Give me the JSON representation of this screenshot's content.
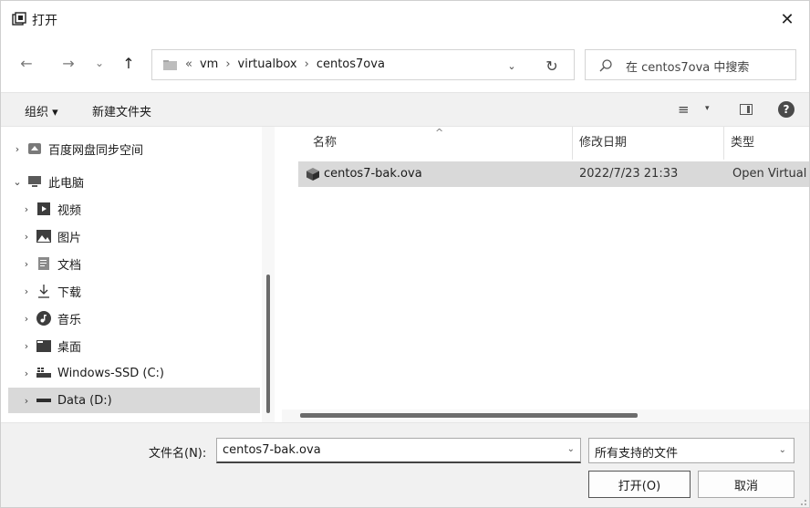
{
  "window": {
    "title": "打开",
    "close_glyph": "✕"
  },
  "nav": {
    "back_glyph": "←",
    "forward_glyph": "→",
    "recent_glyph": "⌄",
    "up_glyph": "↑"
  },
  "address": {
    "overflow": "«",
    "segments": [
      "vm",
      "virtualbox",
      "centos7ova"
    ],
    "separator": "›",
    "dropdown_glyph": "⌄",
    "refresh_glyph": "↻"
  },
  "search": {
    "placeholder": "在 centos7ova 中搜索"
  },
  "toolbar": {
    "organize_label": "组织 ▾",
    "new_folder_label": "新建文件夹",
    "view_glyph": "≡",
    "view_drop_glyph": "▾",
    "help_glyph": "?"
  },
  "sidebar": {
    "items": [
      {
        "label": "百度网盘同步空间",
        "chevron": "›",
        "icon": "cloud-sync-icon"
      },
      {
        "label": "此电脑",
        "chevron": "⌄",
        "icon": "computer-icon"
      },
      {
        "label": "视频",
        "chevron": "›",
        "icon": "video-icon"
      },
      {
        "label": "图片",
        "chevron": "›",
        "icon": "pictures-icon"
      },
      {
        "label": "文档",
        "chevron": "›",
        "icon": "documents-icon"
      },
      {
        "label": "下载",
        "chevron": "›",
        "icon": "download-icon"
      },
      {
        "label": "音乐",
        "chevron": "›",
        "icon": "music-icon"
      },
      {
        "label": "桌面",
        "chevron": "›",
        "icon": "desktop-icon"
      },
      {
        "label": "Windows-SSD (C:)",
        "chevron": "›",
        "icon": "drive-c-icon"
      },
      {
        "label": "Data (D:)",
        "chevron": "›",
        "icon": "drive-d-icon"
      }
    ]
  },
  "file_list": {
    "columns": {
      "name": "名称",
      "modified": "修改日期",
      "type": "类型",
      "sort_glyph": "^"
    },
    "rows": [
      {
        "name": "centos7-bak.ova",
        "modified": "2022/7/23 21:33",
        "type": "Open Virtual",
        "icon": "ova-package-icon"
      }
    ]
  },
  "footer": {
    "filename_label": "文件名(N):",
    "filename_value": "centos7-bak.ova",
    "filename_drop_glyph": "⌄",
    "filter_value": "所有支持的文件",
    "filter_drop_glyph": "⌄",
    "open_label": "打开(O)",
    "cancel_label": "取消"
  }
}
